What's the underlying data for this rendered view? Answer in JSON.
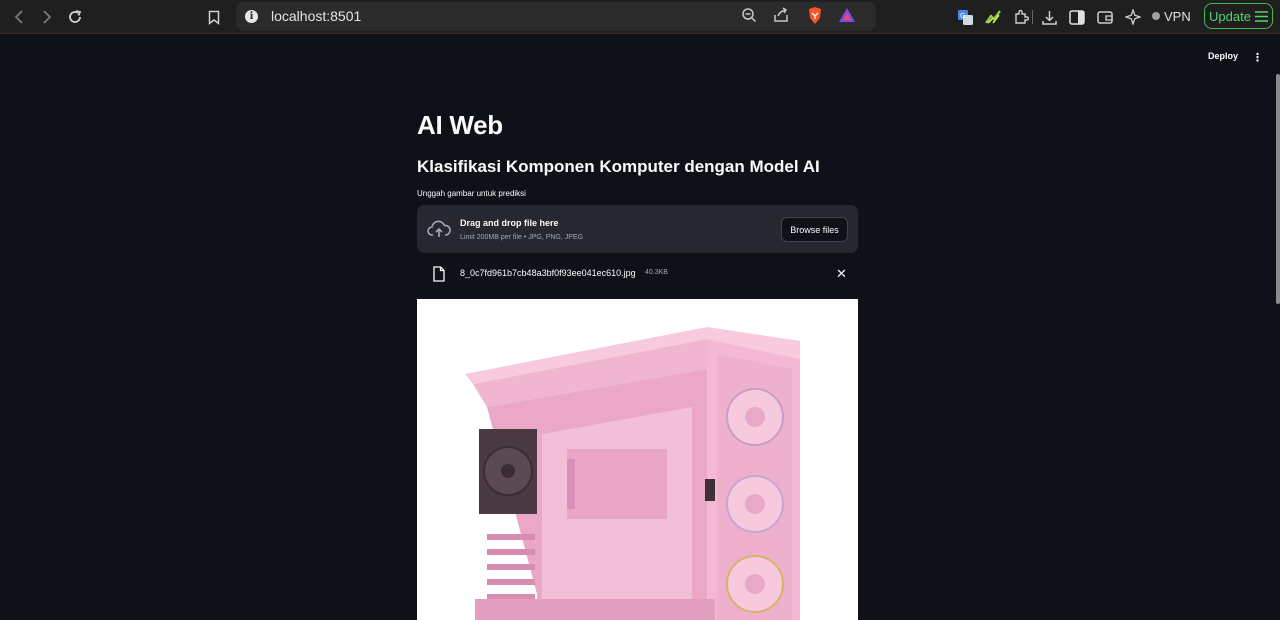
{
  "browser": {
    "url": "localhost:8501",
    "vpn_label": "VPN",
    "update_label": "Update"
  },
  "app": {
    "deploy_label": "Deploy",
    "menu_glyph": "⋮",
    "title": "AI Web",
    "subtitle": "Klasifikasi Komponen Komputer dengan Model AI",
    "uploader": {
      "label": "Unggah gambar untuk prediksi",
      "drop_text": "Drag and drop file here",
      "limit_text": "Limit 200MB per file • JPG, PNG, JPEG",
      "browse_label": "Browse files"
    },
    "uploaded_file": {
      "name": "8_0c7fd961b7cb48a3bf0f93ee041ec610.jpg",
      "size": "40.3KB"
    }
  },
  "colors": {
    "background": "#0e1117",
    "surface": "#262730",
    "text": "#fafafa",
    "accent_update": "#3fb950",
    "pc_case": "#f4b8d4"
  },
  "icons": [
    "back-icon",
    "forward-icon",
    "reload-icon",
    "bookmark-icon",
    "info-icon",
    "zoom-icon",
    "share-icon",
    "brave-shield-icon",
    "rewards-icon",
    "translate-icon",
    "extension-icon",
    "puzzle-icon",
    "download-icon",
    "sidebar-icon",
    "wallet-icon",
    "leo-icon",
    "upload-cloud-icon",
    "file-icon",
    "close-icon",
    "kebab-menu-icon"
  ]
}
